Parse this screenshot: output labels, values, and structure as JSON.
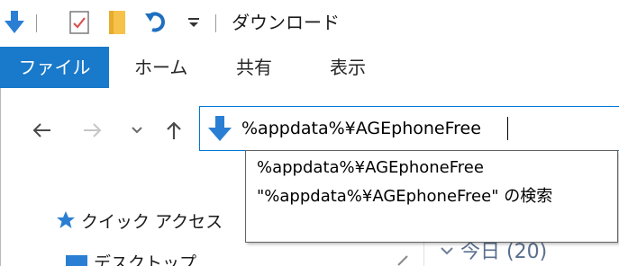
{
  "window": {
    "title": "ダウンロード"
  },
  "quick_access_toolbar": {
    "icons": [
      "download-folder-icon",
      "properties-checklist-icon",
      "new-folder-icon",
      "undo-icon",
      "customize-dropdown-icon"
    ]
  },
  "ribbon": {
    "tabs": [
      {
        "label": "ファイル",
        "active": true
      },
      {
        "label": "ホーム"
      },
      {
        "label": "共有"
      },
      {
        "label": "表示"
      }
    ]
  },
  "navigation": {
    "buttons": [
      "back-arrow-icon",
      "forward-arrow-icon",
      "recent-locations-chevron-icon",
      "up-arrow-icon"
    ]
  },
  "address_bar": {
    "value": "%appdata%¥AGEphoneFree"
  },
  "autocomplete": {
    "items": [
      {
        "label": "%appdata%¥AGEphoneFree"
      },
      {
        "label": "\"%appdata%¥AGEphoneFree\" の検索"
      }
    ]
  },
  "nav_pane": {
    "quick_access": "クイック アクセス",
    "desktop": "デスクトップ"
  },
  "content": {
    "group_header": "今日 (20)"
  },
  "colors": {
    "accent": "#1979ca",
    "address_border": "#0078d7",
    "icon_blue": "#2a7fd4",
    "folder_yellow": "#f6c24a"
  }
}
